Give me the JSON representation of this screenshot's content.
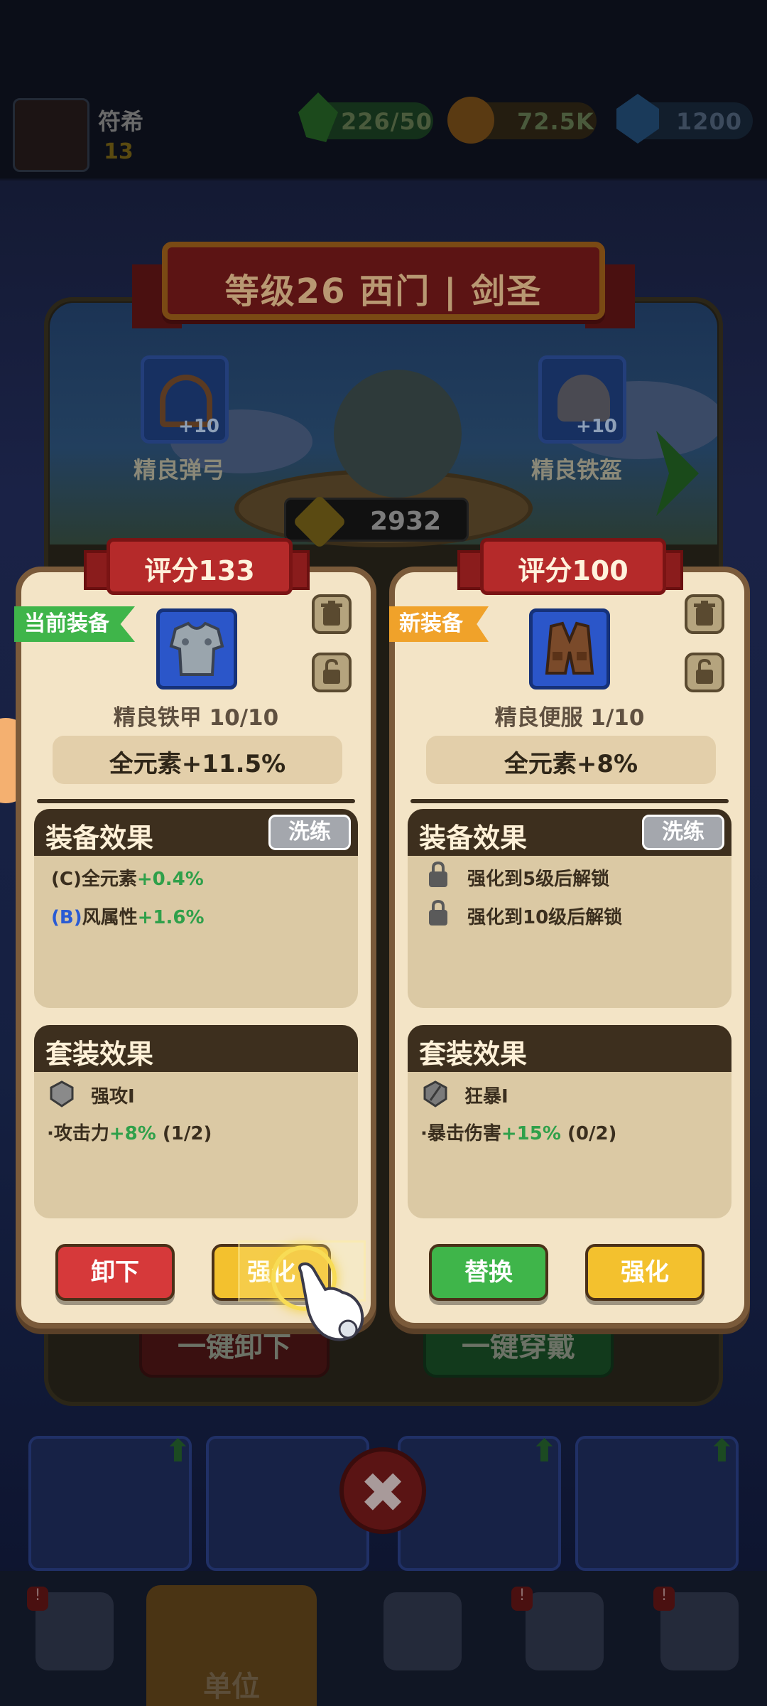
{
  "player": {
    "name": "符希",
    "level": "13"
  },
  "resources": {
    "stamina": "226/50",
    "gold": "72.5K",
    "gems": "1200"
  },
  "header": {
    "title": "等级26 西门 | 剑圣"
  },
  "slots": {
    "left_top": {
      "label": "精良弹弓",
      "plus": "+10"
    },
    "right_top": {
      "label": "精良铁盔",
      "plus": "+10"
    }
  },
  "power": "2932",
  "background_buttons": {
    "unequip_all": "一键卸下",
    "one_key": "一键穿戴"
  },
  "current": {
    "score": "评分133",
    "tag": "当前装备",
    "item_name": "精良铁甲 10/10",
    "main_stat": "全元素+11.5%",
    "effects_title": "装备效果",
    "reforge": "洗练",
    "effects": [
      {
        "grade": "(C)",
        "name": "全元素",
        "value": "+0.4%"
      },
      {
        "grade": "(B)",
        "name": "风属性",
        "value": "+1.6%"
      }
    ],
    "set_title": "套装效果",
    "set_name": "强攻I",
    "set_bonus": {
      "name": "·攻击力",
      "value": "+8%",
      "progress": "(1/2)"
    },
    "btn_left": "卸下",
    "btn_right": "强化"
  },
  "new": {
    "score": "评分100",
    "tag": "新装备",
    "item_name": "精良便服 1/10",
    "main_stat": "全元素+8%",
    "effects_title": "装备效果",
    "reforge": "洗练",
    "locked": [
      "强化到5级后解锁",
      "强化到10级后解锁"
    ],
    "set_title": "套装效果",
    "set_name": "狂暴I",
    "set_bonus": {
      "name": "·暴击伤害",
      "value": "+15%",
      "progress": "(0/2)"
    },
    "btn_left": "替换",
    "btn_right": "强化"
  },
  "nav": {
    "active_label": "单位"
  },
  "colors": {
    "panel_bg": "#f3e4c6",
    "ribbon_red": "#b52a2a",
    "tag_green": "#3fb54a",
    "tag_orange": "#f0a22a",
    "btn_red": "#d6393a",
    "btn_yellow": "#f3c12e",
    "btn_green": "#3fb54a",
    "section_dark": "#3d2f1e"
  }
}
